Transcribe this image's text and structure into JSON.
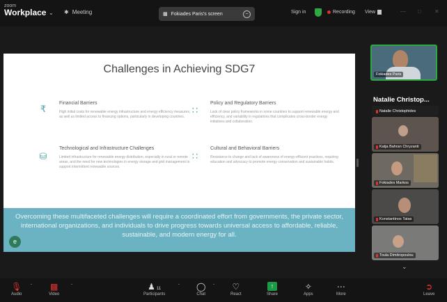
{
  "app": {
    "logo_small": "zoom",
    "logo_big": "Workplace"
  },
  "topbar": {
    "meeting_label": "Meeting",
    "share_label": "Fokiades Paris's screen",
    "signin_label": "Sign in",
    "recording_label": "Recording",
    "view_label": "View"
  },
  "slide": {
    "title": "Challenges in Achieving SDG7",
    "blocks": [
      {
        "heading": "Financial Barriers",
        "text": "High initial costs for renewable energy infrastructure and energy efficiency measures, as well as limited access to financing options, particularly in developing countries.",
        "icon": "rupee-icon"
      },
      {
        "heading": "Policy and Regulatory Barriers",
        "text": "Lack of clear policy frameworks in some countries to support renewable energy and efficiency, and variability in regulations that complicates cross-border energy initiatives and collaboration.",
        "icon": "network-icon"
      },
      {
        "heading": "Technological and Infrastructure Challenges",
        "text": "Limited infrastructure for renewable energy distribution, especially in rural or remote areas, and the need for new technologies in energy storage and grid management to support intermittent renewable sources.",
        "icon": "database-icon"
      },
      {
        "heading": "Cultural and Behavioral Barriers",
        "text": "Resistance to change and lack of awareness of energy-efficient practices, requiring education and advocacy to promote energy conservation and sustainable habits.",
        "icon": "grid-icon"
      }
    ],
    "banner": "Overcoming these multifaceted challenges will require a coordinated effort from governments, the private sector, international organizations, and individuals to drive progress towards universal access to affordable, reliable, sustainable, and modern energy for all.",
    "banner_logo": "e"
  },
  "gallery": {
    "active_speaker_short": "Fokiades Paris",
    "active_speaker_title": "Natalie Christop...",
    "tiles": [
      {
        "name": "Natalie Christophides"
      },
      {
        "name": "Katja Bahran Chryzanti"
      },
      {
        "name": "Fokiades Markos"
      },
      {
        "name": "Konstantinos Tatas"
      },
      {
        "name": "Toula Dimitropoulou"
      }
    ]
  },
  "toolbar": {
    "audio": "Audio",
    "video": "Video",
    "participants": "Participants",
    "participants_count": "11",
    "chat": "Chat",
    "react": "React",
    "share": "Share",
    "apps": "Apps",
    "more": "More",
    "leave": "Leave"
  },
  "colors": {
    "accent_green": "#1d9a45",
    "recording_red": "#e0322e",
    "banner_teal": "#6bb3c2",
    "icon_teal": "#4aa1a8"
  }
}
